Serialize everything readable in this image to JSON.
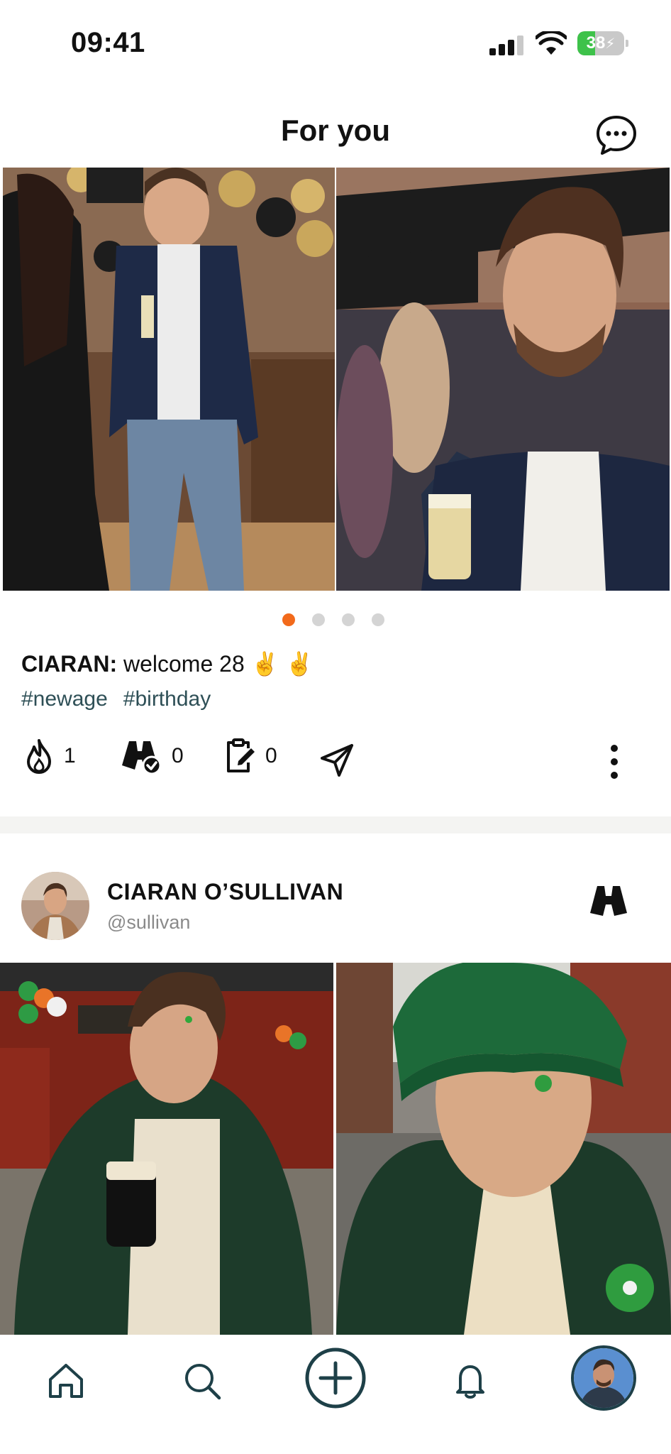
{
  "status_bar": {
    "time": "09:41",
    "battery_level": "38",
    "battery_fraction": 0.38,
    "signal_bars": 4,
    "signal_active_bars": 3,
    "icons": [
      "cellular-signal-icon",
      "wifi-icon",
      "battery-charging-icon"
    ]
  },
  "header": {
    "title": "For you",
    "chat_icon": "chat-bubble-dots-icon"
  },
  "post1": {
    "carousel": {
      "page_count": 4,
      "active_page": 1,
      "active_color": "#f26a1b",
      "inactive_color": "#d4d4d4"
    },
    "caption_author": "CIARAN:",
    "caption_text": "welcome 28 ✌️ ✌️",
    "hashtags": [
      "#newage",
      "#birthday"
    ],
    "actions": {
      "flame_count": "1",
      "binoculars_count": "0",
      "clipboard_count": "0",
      "icons": [
        "flame-icon",
        "binoculars-check-icon",
        "clipboard-edit-icon",
        "send-icon",
        "more-vertical-icon"
      ]
    }
  },
  "post2": {
    "author_name": "CIARAN O’SULLIVAN",
    "author_handle": "@sullivan",
    "follow_icon": "binoculars-icon"
  },
  "bottom_nav": {
    "items": [
      "home-icon",
      "search-icon",
      "create-post-icon",
      "notifications-bell-icon",
      "profile-avatar"
    ]
  },
  "colors": {
    "accent": "#f26a1b",
    "hashtag": "#2e4f56",
    "nav_icon": "#1e4048",
    "battery_fill": "#3ec24a"
  }
}
